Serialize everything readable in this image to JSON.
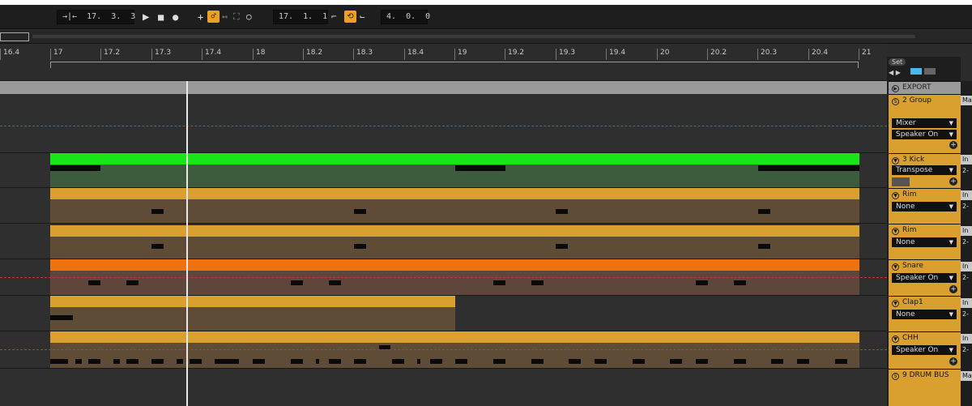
{
  "transport": {
    "follow_icon": "→|←",
    "position": "17.  3.  3",
    "play_icon": "play-icon",
    "stop_icon": "stop-icon",
    "record_icon": "record-icon",
    "loop_start": "17.  1.  1",
    "loop_length": "4.  0.  0"
  },
  "ruler": {
    "ticks": [
      "16.4",
      "17",
      "17.2",
      "17.3",
      "17.4",
      "18",
      "18.2",
      "18.3",
      "18.4",
      "19",
      "19.2",
      "19.3",
      "19.4",
      "20",
      "20.2",
      "20.3",
      "20.4",
      "21"
    ],
    "set_label": "Set"
  },
  "tracks": [
    {
      "name": "EXPORT",
      "device": ""
    },
    {
      "name": "2 Group",
      "device": "Mixer",
      "device2": "Speaker On"
    },
    {
      "name": "3 Kick",
      "device": "Transpose"
    },
    {
      "name": "Rim",
      "device": "None"
    },
    {
      "name": "Rim",
      "device": "None"
    },
    {
      "name": "Snare",
      "device": "Speaker On"
    },
    {
      "name": "Clap1",
      "device": "None"
    },
    {
      "name": "CHH",
      "device": "Speaker On"
    },
    {
      "name": "9 DRUM BUS",
      "device": ""
    }
  ],
  "io": {
    "ma1": "Ma",
    "in": "In",
    "ch": "2-",
    "ma2": "Ma"
  },
  "colors": {
    "kick": "#19e619",
    "rim": "#d9a030",
    "snare": "#f0720e",
    "clap": "#d9a030",
    "chh": "#d9a030"
  }
}
